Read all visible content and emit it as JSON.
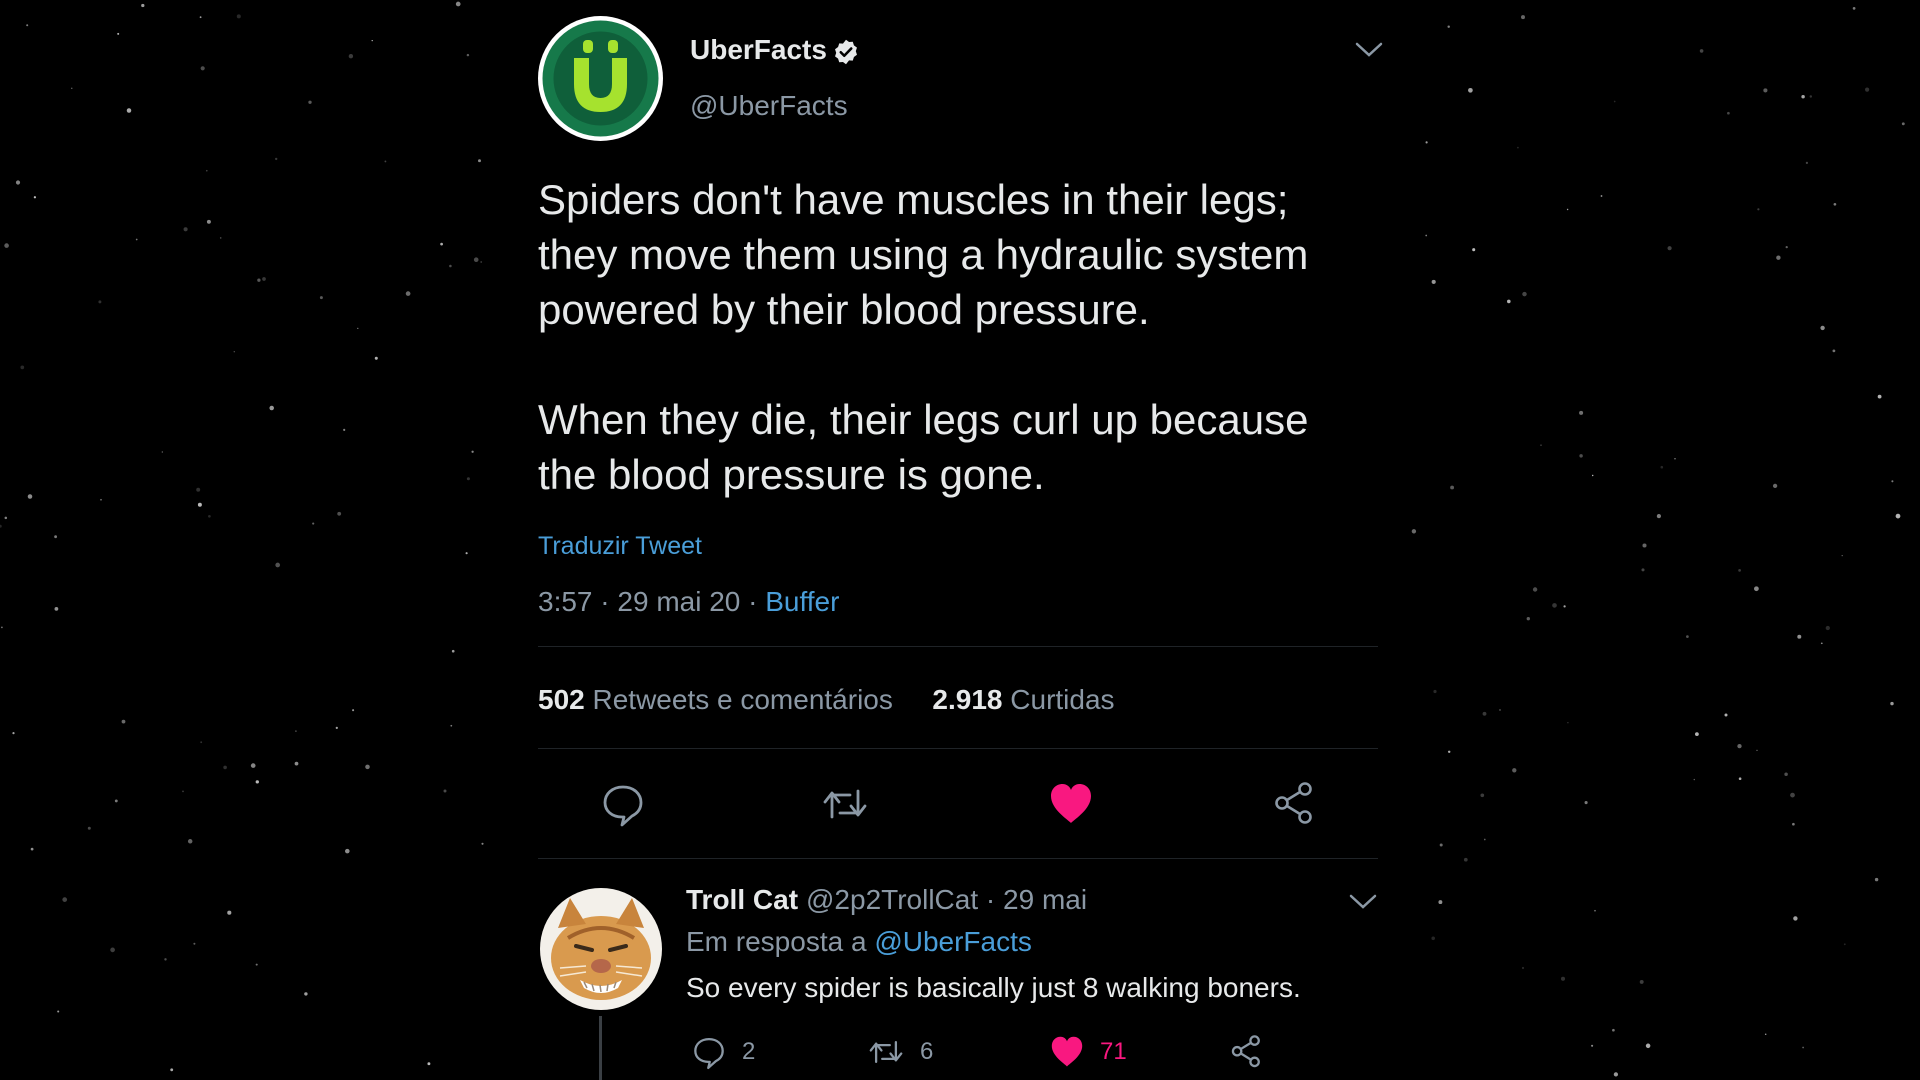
{
  "tweet": {
    "author_name": "UberFacts",
    "author_handle": "@UberFacts",
    "avatar_letter": "Ü",
    "text": "Spiders don't have muscles in their legs;\nthey move them using a hydraulic system\npowered by their blood pressure.\n\nWhen they die, their legs curl up because\nthe blood pressure is gone.",
    "translate_label": "Traduzir Tweet",
    "time": "3:57",
    "date": "29 mai 20",
    "separator": "·",
    "source": "Buffer",
    "retweets_count": "502",
    "retweets_label": "Retweets e comentários",
    "likes_count": "2.918",
    "likes_label": "Curtidas"
  },
  "reply": {
    "author_name": "Troll Cat",
    "author_handle": "@2p2TrollCat",
    "date": "29 mai",
    "reply_to_prefix": "Em resposta a",
    "reply_to_mention": "@UberFacts",
    "text": "So every spider is basically just 8 walking boners.",
    "reply_count": "2",
    "retweet_count": "6",
    "like_count": "71"
  },
  "colors": {
    "background": "#000000",
    "text_primary": "#e7e9ea",
    "text_secondary": "#8b98a5",
    "link": "#4a9ed9",
    "like": "#f91880",
    "avatar_green": "#16794a",
    "avatar_lime": "#a6e22e"
  },
  "icons": {
    "verified": "verified-badge-icon",
    "reply": "speech-bubble-icon",
    "retweet": "retweet-arrows-icon",
    "like": "heart-icon",
    "share": "share-icon",
    "caret": "chevron-down-icon"
  }
}
